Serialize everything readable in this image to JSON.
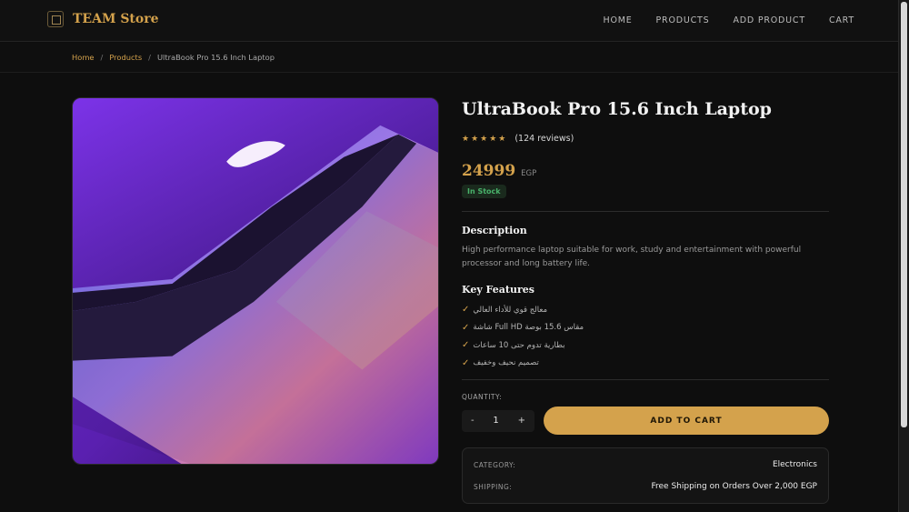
{
  "brand": {
    "name": "TEAM Store"
  },
  "nav": [
    "HOME",
    "PRODUCTS",
    "ADD PRODUCT",
    "CART"
  ],
  "breadcrumb": {
    "home": "Home",
    "sep": "/",
    "products": "Products",
    "current": "UltraBook Pro 15.6 Inch Laptop"
  },
  "product": {
    "title": "UltraBook Pro 15.6 Inch Laptop",
    "stars": "★★★★★",
    "reviews": "(124 reviews)",
    "price": "24999",
    "currency": "EGP",
    "stock": "In Stock",
    "description_title": "Description",
    "description": "High performance laptop suitable for work, study and entertainment with powerful processor and long battery life.",
    "features_title": "Key Features",
    "check": "✓",
    "features": [
      "معالج قوي للأداء العالي",
      "شاشة Full HD مقاس 15.6 بوصة",
      "بطارية تدوم حتى 10 ساعات",
      "تصميم نحيف وخفيف"
    ]
  },
  "cart": {
    "quantity_label": "QUANTITY:",
    "minus": "-",
    "quantity": "1",
    "plus": "+",
    "add_label": "ADD TO CART"
  },
  "meta": {
    "category_label": "CATEGORY:",
    "category": "Electronics",
    "shipping_label": "SHIPPING:",
    "shipping": "Free Shipping on Orders Over 2,000 EGP"
  },
  "colors": {
    "accent": "#d4a24c",
    "background": "#0e0e0e",
    "stock_green": "#49b36b"
  },
  "icons": {
    "brand": "store-logo-icon",
    "image": "laptop-photo"
  }
}
